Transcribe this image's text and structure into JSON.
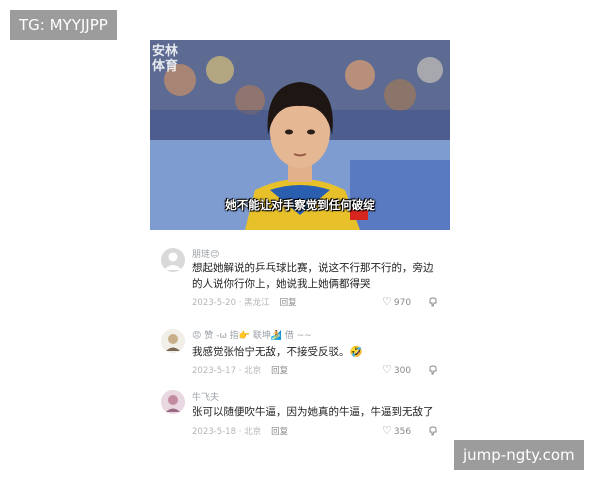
{
  "watermark_left": "TG: MYYJJPP",
  "watermark_right": "jump-ngty.com",
  "video": {
    "logo": "安林体育",
    "subtitle": "她不能让对手察觉到任何破绽"
  },
  "comments": [
    {
      "username": "朋琏😊",
      "text": "想起她解说的乒乓球比赛，说这不行那不行的，旁边的人说你行你上，她说我上她俩都得哭",
      "date": "2023-5-20 · 黑龙江",
      "reply": "回复",
      "likes": "970"
    },
    {
      "username": "😡 赞 -ω 指👉 联坤🏄 借 ~~",
      "text": "我感觉张怡宁无敌，不接受反驳。🤣",
      "date": "2023-5-17 · 北京",
      "reply": "回复",
      "likes": "300"
    },
    {
      "username": "牛飞夫",
      "text": "张可以随便吹牛逼，因为她真的牛逼，牛逼到无敌了",
      "date": "2023-5-18 · 北京",
      "reply": "回复",
      "likes": "356"
    }
  ]
}
